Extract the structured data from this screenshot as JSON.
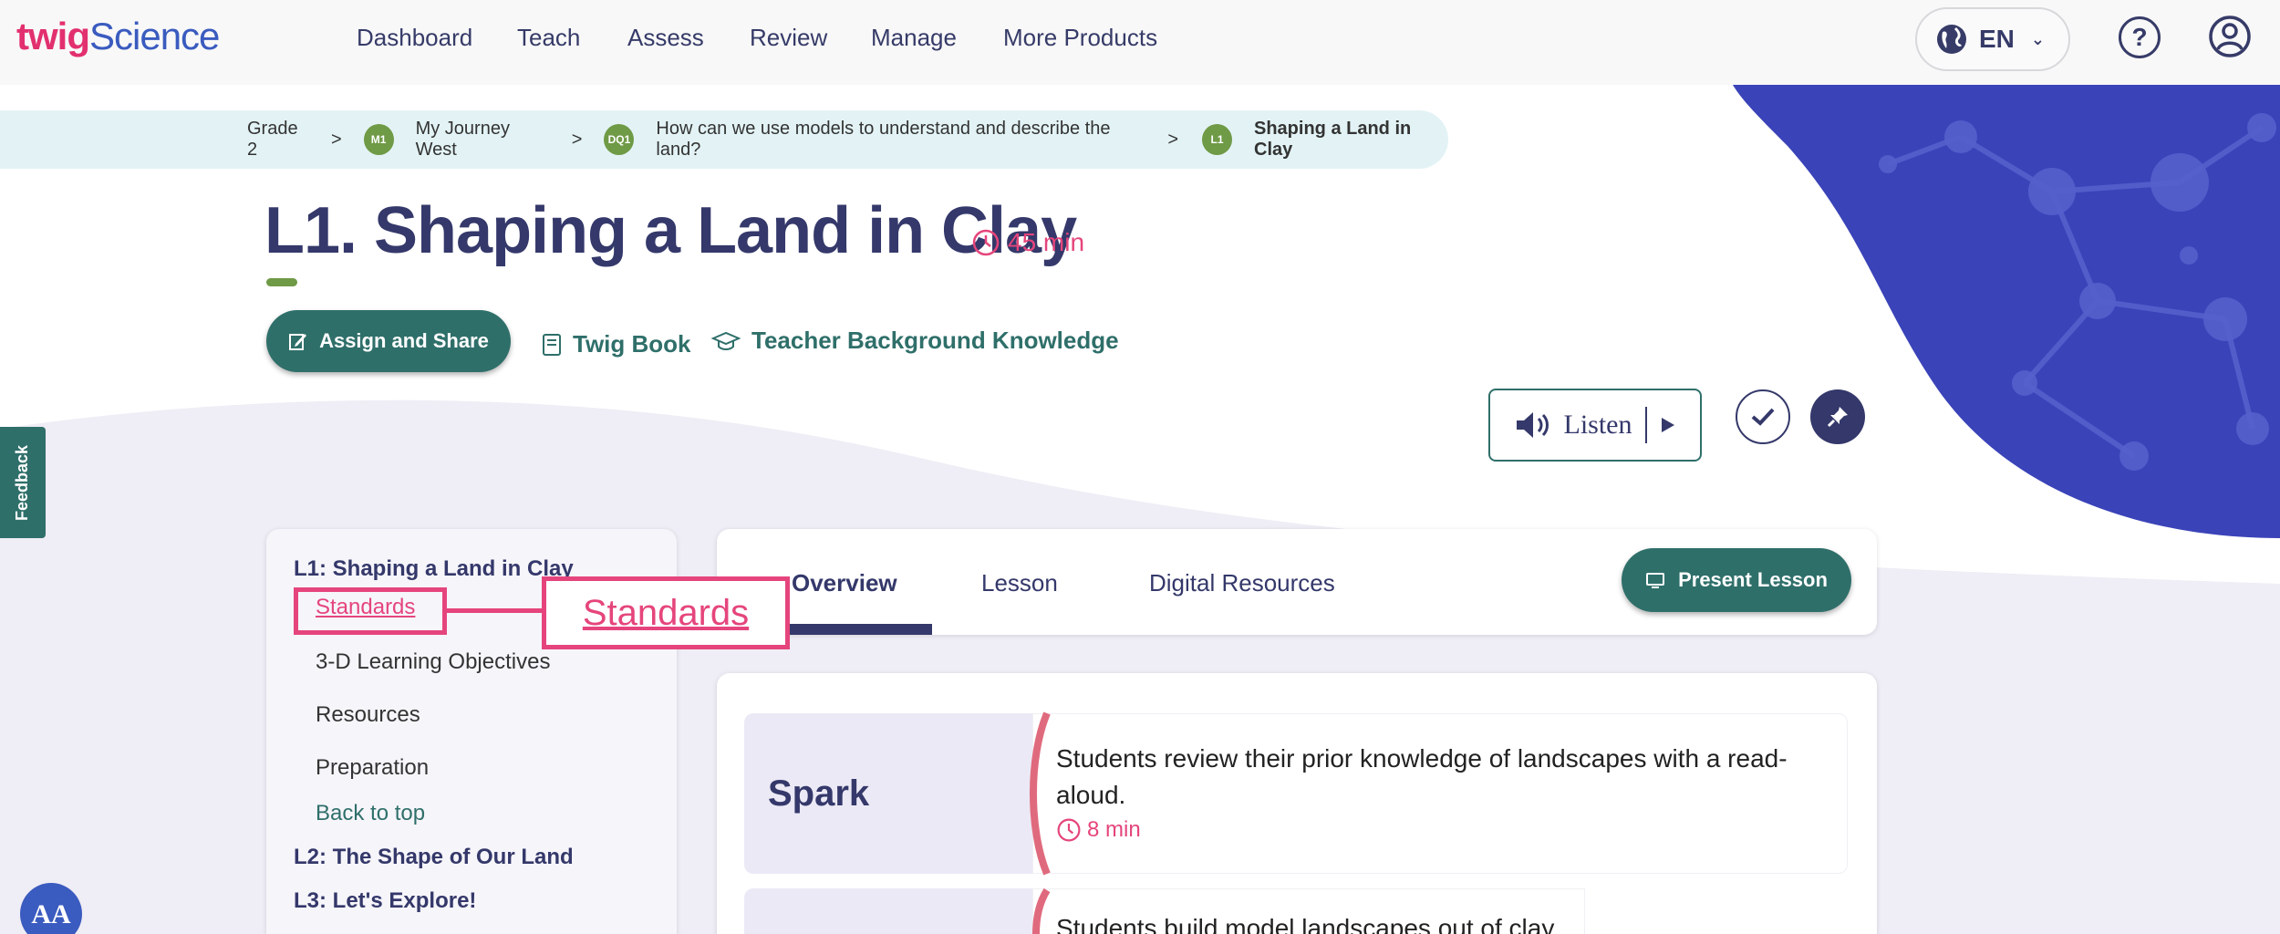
{
  "header": {
    "logo_twig": "twig",
    "logo_science": "Science",
    "nav": [
      "Dashboard",
      "Teach",
      "Assess",
      "Review",
      "Manage",
      "More Products"
    ],
    "language": "EN"
  },
  "breadcrumb": {
    "grade": "Grade 2",
    "m_badge": "M1",
    "module": "My Journey West",
    "dq_badge": "DQ1",
    "question": "How can we use models to understand and describe the land?",
    "l_badge": "L1",
    "lesson": "Shaping a Land in Clay",
    "separator": ">"
  },
  "lesson": {
    "title": "L1. Shaping a Land in Clay",
    "duration": "45 min",
    "assign_label": "Assign and Share",
    "twig_book_label": "Twig Book",
    "teacher_knowledge_label": "Teacher Background Knowledge",
    "listen_label": "Listen"
  },
  "feedback_label": "Feedback",
  "toc": {
    "current_lesson": "L1: Shaping a Land in Clay",
    "sub_items": [
      "Standards",
      "3-D Learning Objectives",
      "Resources",
      "Preparation"
    ],
    "back_to_top": "Back to top",
    "other_lessons": [
      "L2: The Shape of Our Land",
      "L3: Let's Explore!"
    ]
  },
  "highlight_label": "Standards",
  "tabs": {
    "items": [
      "Overview",
      "Lesson",
      "Digital Resources"
    ],
    "present_label": "Present Lesson"
  },
  "phases": [
    {
      "name": "Spark",
      "description": "Students review their prior knowledge of landscapes with a read-aloud.",
      "duration": "8 min"
    },
    {
      "description": "Students build model landscapes out of clay."
    }
  ],
  "accessibility_label": "AA",
  "colors": {
    "brand_pink": "#e2306f",
    "brand_blue": "#3a5bbf",
    "teal": "#2f6f6a",
    "navy": "#34386a",
    "green_badge": "#6f9a46",
    "highlight": "#e5457c"
  }
}
